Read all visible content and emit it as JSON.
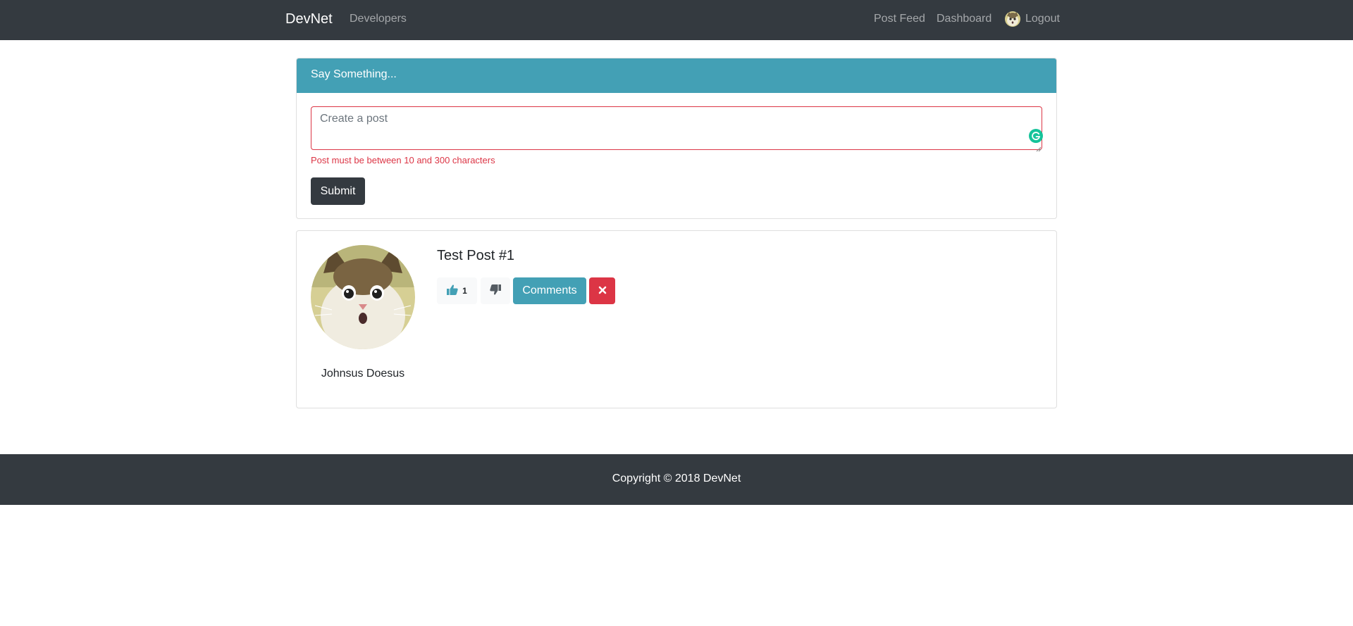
{
  "navbar": {
    "brand": "DevNet",
    "left_links": [
      {
        "label": "Developers"
      }
    ],
    "right_links": [
      {
        "label": "Post Feed"
      },
      {
        "label": "Dashboard"
      }
    ],
    "logout_label": "Logout",
    "avatar_icon": "cat-avatar-icon"
  },
  "post_form": {
    "header": "Say Something...",
    "textarea_value": "",
    "textarea_placeholder": "Create a post",
    "error_text": "Post must be between 10 and 300 characters",
    "submit_label": "Submit"
  },
  "post": {
    "author_name": "Johnsus Doesus",
    "text": "Test Post #1",
    "like_count": "1",
    "comments_label": "Comments",
    "like_icon": "thumbs-up-icon",
    "unlike_icon": "thumbs-down-icon",
    "delete_icon": "close-x-icon"
  },
  "footer": {
    "copyright": "Copyright © 2018 DevNet"
  },
  "colors": {
    "navbar_bg": "#343a40",
    "info": "#43a0b5",
    "danger": "#dc3545",
    "light": "#f8f9fa",
    "grammarly": "#15c39a"
  }
}
